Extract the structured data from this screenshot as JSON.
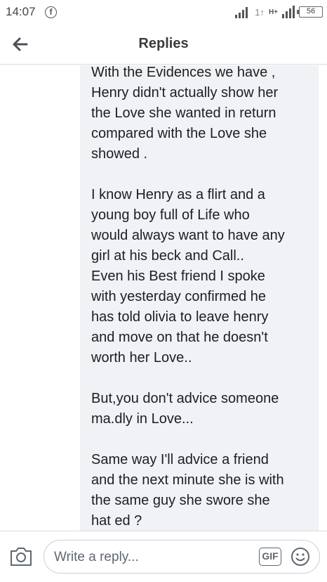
{
  "status_bar": {
    "time": "14:07",
    "fb_badge": "f",
    "signal_label": "1↑",
    "network": "H+",
    "battery": "56"
  },
  "header": {
    "title": "Replies",
    "back_icon": "arrow-left-icon"
  },
  "comment": {
    "paragraphs": [
      "With the Evidences we have ,\nHenry didn't actually show her\nthe Love she wanted in return\ncompared with the Love she\nshowed .",
      "I know Henry as a flirt and a\nyoung boy full of Life who\nwould always want to have any\ngirl at his beck and Call..\nEven his Best friend I spoke\nwith yesterday confirmed he\nhas told olivia to leave henry\nand move on that he doesn't\nworth her Love..",
      "But,you don't advice someone\nma.dly in Love...",
      "Same way I'll advice a friend\nand the next minute she is with\nthe same guy she swore she\nhat ed ?"
    ]
  },
  "composer": {
    "placeholder": "Write a reply...",
    "gif_label": "GIF",
    "camera_icon": "camera-icon",
    "emoji_icon": "smiley-icon"
  },
  "colors": {
    "bubble_bg": "#f0f2f5",
    "text": "#1c1e21",
    "icon": "#606770"
  }
}
